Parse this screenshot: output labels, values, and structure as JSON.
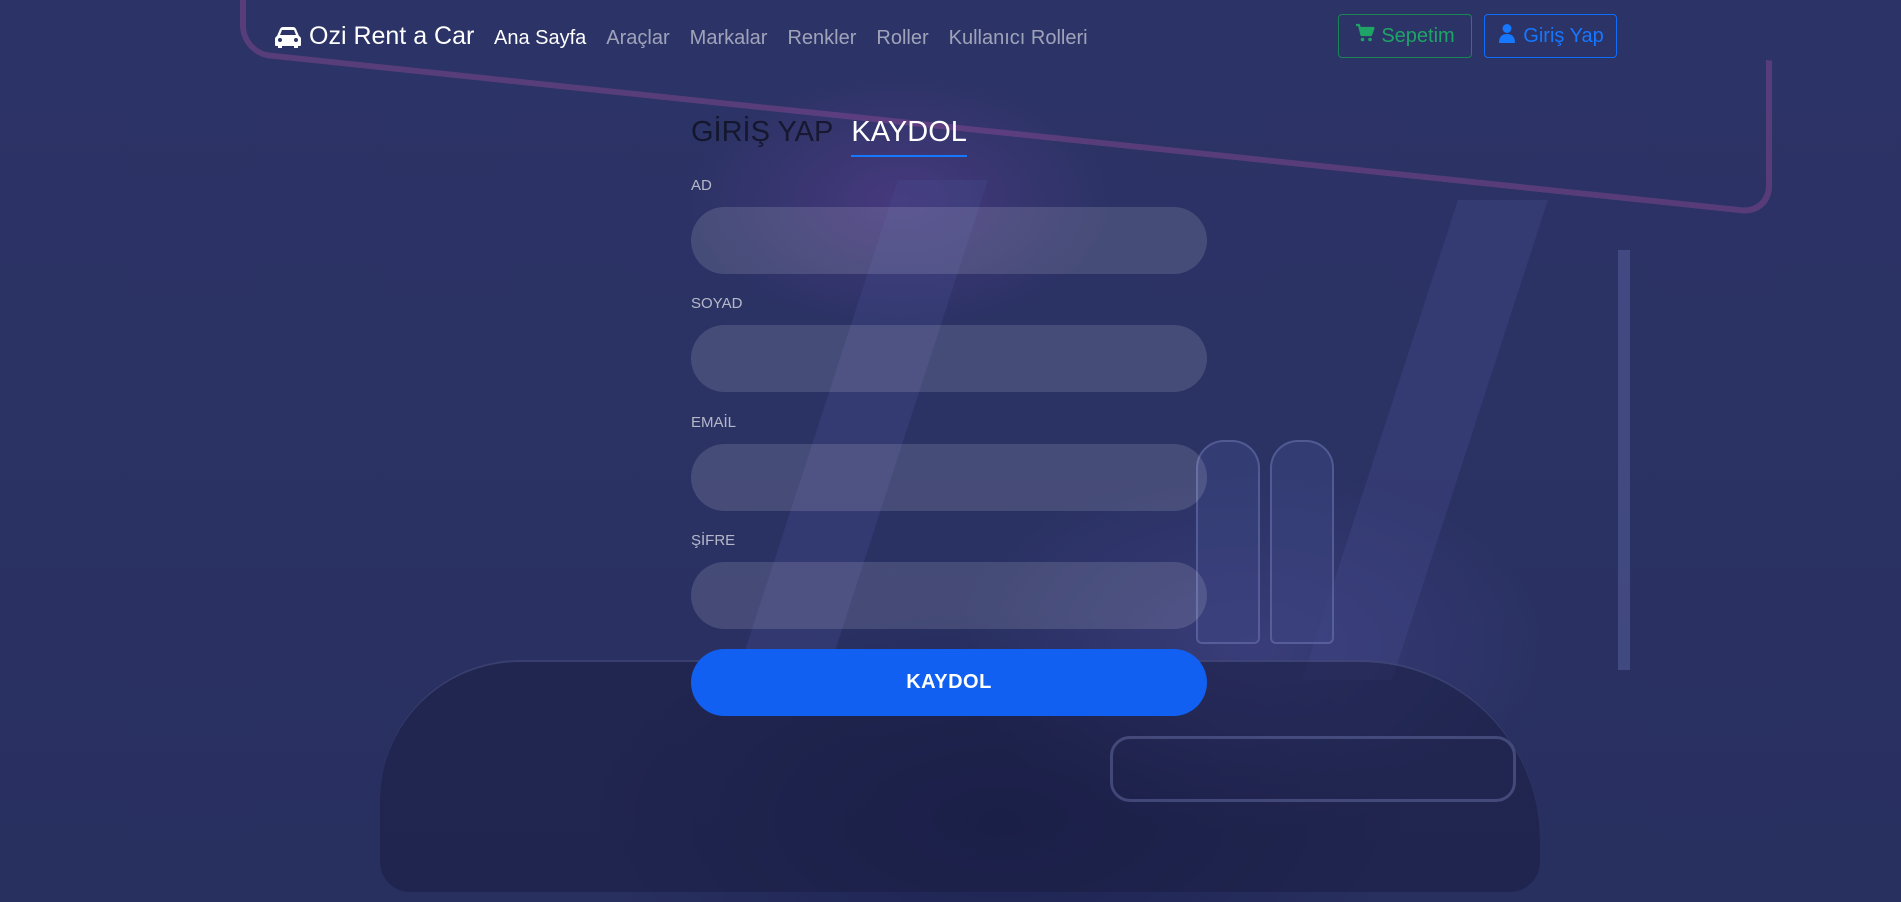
{
  "navbar": {
    "brand": "Ozi Rent a Car",
    "brand_icon": "car-icon",
    "links": [
      {
        "label": "Ana Sayfa",
        "active": true
      },
      {
        "label": "Araçlar"
      },
      {
        "label": "Markalar"
      },
      {
        "label": "Renkler"
      },
      {
        "label": "Roller"
      },
      {
        "label": "Kullanıcı Rolleri"
      }
    ],
    "cart_button": {
      "label": "Sepetim",
      "icon": "shopping-cart-icon",
      "color": "#198754"
    },
    "login_button": {
      "label": "Giriş Yap",
      "icon": "user-icon",
      "color": "#0d6efd"
    }
  },
  "form": {
    "tabs": [
      {
        "label": "GİRİŞ YAP",
        "active": false
      },
      {
        "label": "KAYDOL",
        "active": true
      }
    ],
    "fields": [
      {
        "label": "AD",
        "value": "",
        "placeholder": ""
      },
      {
        "label": "SOYAD",
        "value": "",
        "placeholder": ""
      },
      {
        "label": "EMAİL",
        "value": "",
        "placeholder": ""
      },
      {
        "label": "ŞİFRE",
        "value": "",
        "placeholder": ""
      }
    ],
    "submit_label": "KAYDOL"
  },
  "colors": {
    "accent": "#1160f2",
    "background": "#2c3366"
  }
}
